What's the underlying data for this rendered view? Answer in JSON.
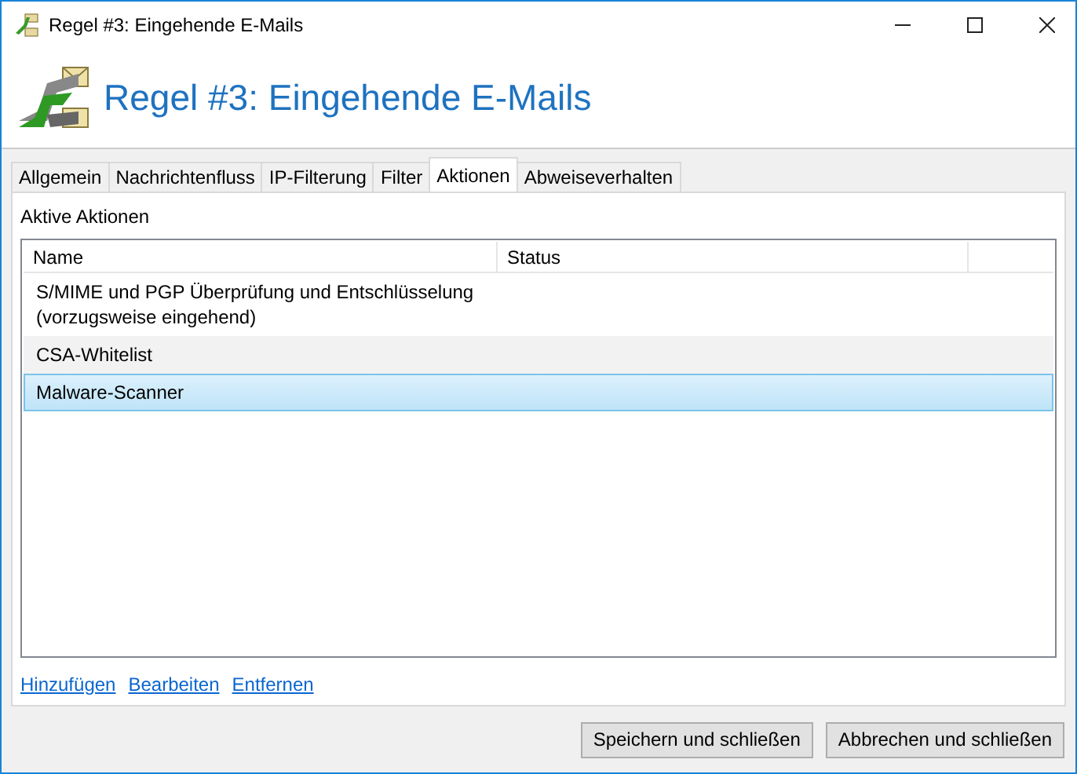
{
  "window": {
    "title": "Regel #3: Eingehende E-Mails"
  },
  "header": {
    "title": "Regel #3: Eingehende E-Mails"
  },
  "tabs": [
    {
      "label": "Allgemein",
      "selected": false
    },
    {
      "label": "Nachrichtenfluss",
      "selected": false
    },
    {
      "label": "IP-Filterung",
      "selected": false
    },
    {
      "label": "Filter",
      "selected": false
    },
    {
      "label": "Aktionen",
      "selected": true
    },
    {
      "label": "Abweiseverhalten",
      "selected": false
    }
  ],
  "section_label": "Aktive Aktionen",
  "table": {
    "columns": [
      "Name",
      "Status"
    ],
    "rows": [
      {
        "name": "S/MIME und PGP Überprüfung und Entschlüsselung\n(vorzugsweise eingehend)",
        "selected": false
      },
      {
        "name": "CSA-Whitelist",
        "selected": false
      },
      {
        "name": "Malware-Scanner",
        "selected": true
      }
    ]
  },
  "links": [
    "Hinzufügen",
    "Bearbeiten",
    "Entfernen"
  ],
  "buttons": [
    "Speichern und schließen",
    "Abbrechen und schließen"
  ]
}
